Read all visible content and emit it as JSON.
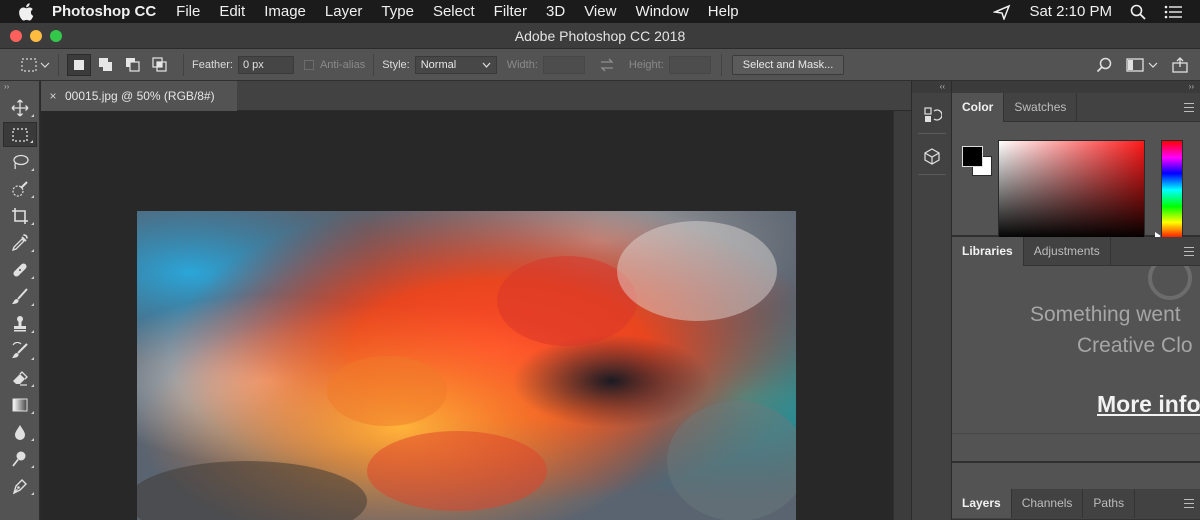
{
  "menubar": {
    "app_name": "Photoshop CC",
    "menus": [
      "File",
      "Edit",
      "Image",
      "Layer",
      "Type",
      "Select",
      "Filter",
      "3D",
      "View",
      "Window",
      "Help"
    ],
    "clock": "Sat 2:10 PM",
    "icons": [
      "apple-icon",
      "location-icon",
      "spotlight-search-icon",
      "notification-list-icon"
    ]
  },
  "window": {
    "title": "Adobe Photoshop CC 2018"
  },
  "options": {
    "feather_label": "Feather:",
    "feather_value": "0 px",
    "antialias_label": "Anti-alias",
    "style_label": "Style:",
    "style_value": "Normal",
    "width_label": "Width:",
    "height_label": "Height:",
    "select_mask_label": "Select and Mask..."
  },
  "document": {
    "tab_title": "00015.jpg @ 50% (RGB/8#)",
    "close_glyph": "×"
  },
  "tools": [
    "move-tool",
    "rectangular-marquee-tool",
    "lasso-tool",
    "quick-selection-tool",
    "crop-tool",
    "eyedropper-tool",
    "healing-brush-tool",
    "brush-tool",
    "clone-stamp-tool",
    "history-brush-tool",
    "eraser-tool",
    "gradient-tool",
    "blur-tool",
    "dodge-tool",
    "pen-tool"
  ],
  "active_tool": "rectangular-marquee-tool",
  "panels": {
    "color_tabs": [
      "Color",
      "Swatches"
    ],
    "libraries_tabs": [
      "Libraries",
      "Adjustments"
    ],
    "layers_tabs": [
      "Layers",
      "Channels",
      "Paths"
    ],
    "libraries_message_line1": "Something went",
    "libraries_message_line2": "Creative Clo",
    "libraries_link": "More info"
  },
  "colors": {
    "foreground": "#000000",
    "background": "#ffffff",
    "ui_panel": "#535353",
    "ui_dark": "#282828"
  }
}
